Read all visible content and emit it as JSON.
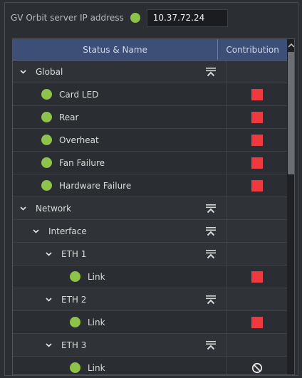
{
  "header": {
    "ip_label": "GV Orbit server IP address",
    "ip_value": "10.37.72.24",
    "status_color": "#8ec34b"
  },
  "table": {
    "columns": [
      "Status & Name",
      "Contribution"
    ],
    "rows": [
      {
        "type": "group",
        "label": "Global",
        "level": 0,
        "expanded": true,
        "contribution": "none"
      },
      {
        "type": "item",
        "label": "Card LED",
        "level": 1,
        "status": "green",
        "contribution": "red"
      },
      {
        "type": "item",
        "label": "Rear",
        "level": 1,
        "status": "green",
        "contribution": "red"
      },
      {
        "type": "item",
        "label": "Overheat",
        "level": 1,
        "status": "green",
        "contribution": "red"
      },
      {
        "type": "item",
        "label": "Fan Failure",
        "level": 1,
        "status": "green",
        "contribution": "red"
      },
      {
        "type": "item",
        "label": "Hardware Failure",
        "level": 1,
        "status": "green",
        "contribution": "red"
      },
      {
        "type": "group",
        "label": "Network",
        "level": 0,
        "expanded": true,
        "contribution": "none"
      },
      {
        "type": "group",
        "label": "Interface",
        "level": 1,
        "expanded": true,
        "contribution": "none"
      },
      {
        "type": "group",
        "label": "ETH 1",
        "level": 2,
        "expanded": true,
        "contribution": "none"
      },
      {
        "type": "item",
        "label": "Link",
        "level": 3,
        "status": "green",
        "contribution": "red"
      },
      {
        "type": "group",
        "label": "ETH 2",
        "level": 2,
        "expanded": true,
        "contribution": "none"
      },
      {
        "type": "item",
        "label": "Link",
        "level": 3,
        "status": "green",
        "contribution": "red"
      },
      {
        "type": "group",
        "label": "ETH 3",
        "level": 2,
        "expanded": true,
        "contribution": "none"
      },
      {
        "type": "item",
        "label": "Link",
        "level": 3,
        "status": "green",
        "contribution": "disabled"
      }
    ]
  },
  "icons": {
    "collapse": "collapse-all-icon",
    "chevron": "chevron-down-icon",
    "disabled": "no-entry-icon",
    "scroll_up": "scroll-up-arrow-icon"
  },
  "colors": {
    "status_green": "#8ec34b",
    "contribution_red": "#ee3a3f",
    "header_blue": "#3d4f77"
  }
}
